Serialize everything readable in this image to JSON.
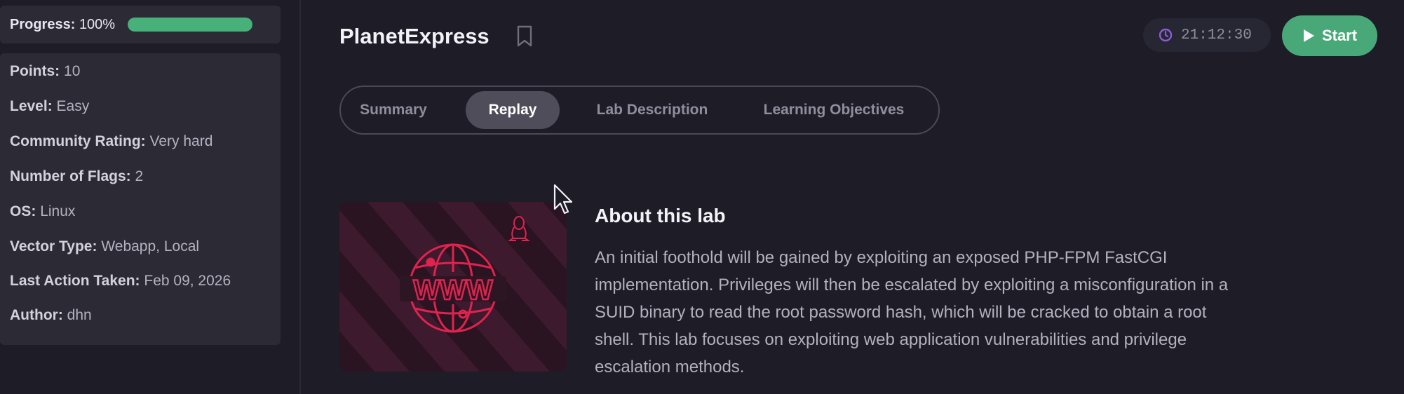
{
  "sidebar": {
    "progress": {
      "label": "Progress:",
      "value_text": "100%",
      "fraction": 1.0
    },
    "details": [
      {
        "key": "Points:",
        "value": "10"
      },
      {
        "key": "Level:",
        "value": "Easy"
      },
      {
        "key": "Community Rating:",
        "value": "Very hard"
      },
      {
        "key": "Number of Flags:",
        "value": "2"
      },
      {
        "key": "OS:",
        "value": "Linux"
      },
      {
        "key": "Vector Type:",
        "value": "Webapp, Local"
      },
      {
        "key": "Last Action Taken:",
        "value": "Feb 09, 2026"
      },
      {
        "key": "Author:",
        "value": "dhn"
      }
    ]
  },
  "header": {
    "title": "PlanetExpress",
    "timer": "21:12:30",
    "start_label": "Start"
  },
  "tabs": [
    {
      "label": "Summary",
      "active": false
    },
    {
      "label": "Replay",
      "active": true
    },
    {
      "label": "Lab Description",
      "active": false
    },
    {
      "label": "Learning Objectives",
      "active": false
    }
  ],
  "about": {
    "title": "About this lab",
    "lines": [
      "An initial foothold will be gained by exploiting an exposed PHP-FPM FastCGI",
      "implementation. Privileges will then be escalated by exploiting a misconfiguration in a",
      "SUID binary to read the root password hash, which will be cracked to obtain a root",
      "shell. This lab focuses on exploiting web application vulnerabilities and privilege",
      "escalation methods."
    ]
  },
  "icons": {
    "bookmark": "bookmark-icon",
    "clock": "clock-icon",
    "play": "play-icon",
    "globe": "www-globe-icon",
    "os": "linux-tux-icon",
    "cursor": "mouse-cursor-icon"
  },
  "colors": {
    "accent_green": "#48a878",
    "progress_green": "#48b17a",
    "thumbnail_red": "#e0234e",
    "clock_purple": "#8a5cd6"
  }
}
